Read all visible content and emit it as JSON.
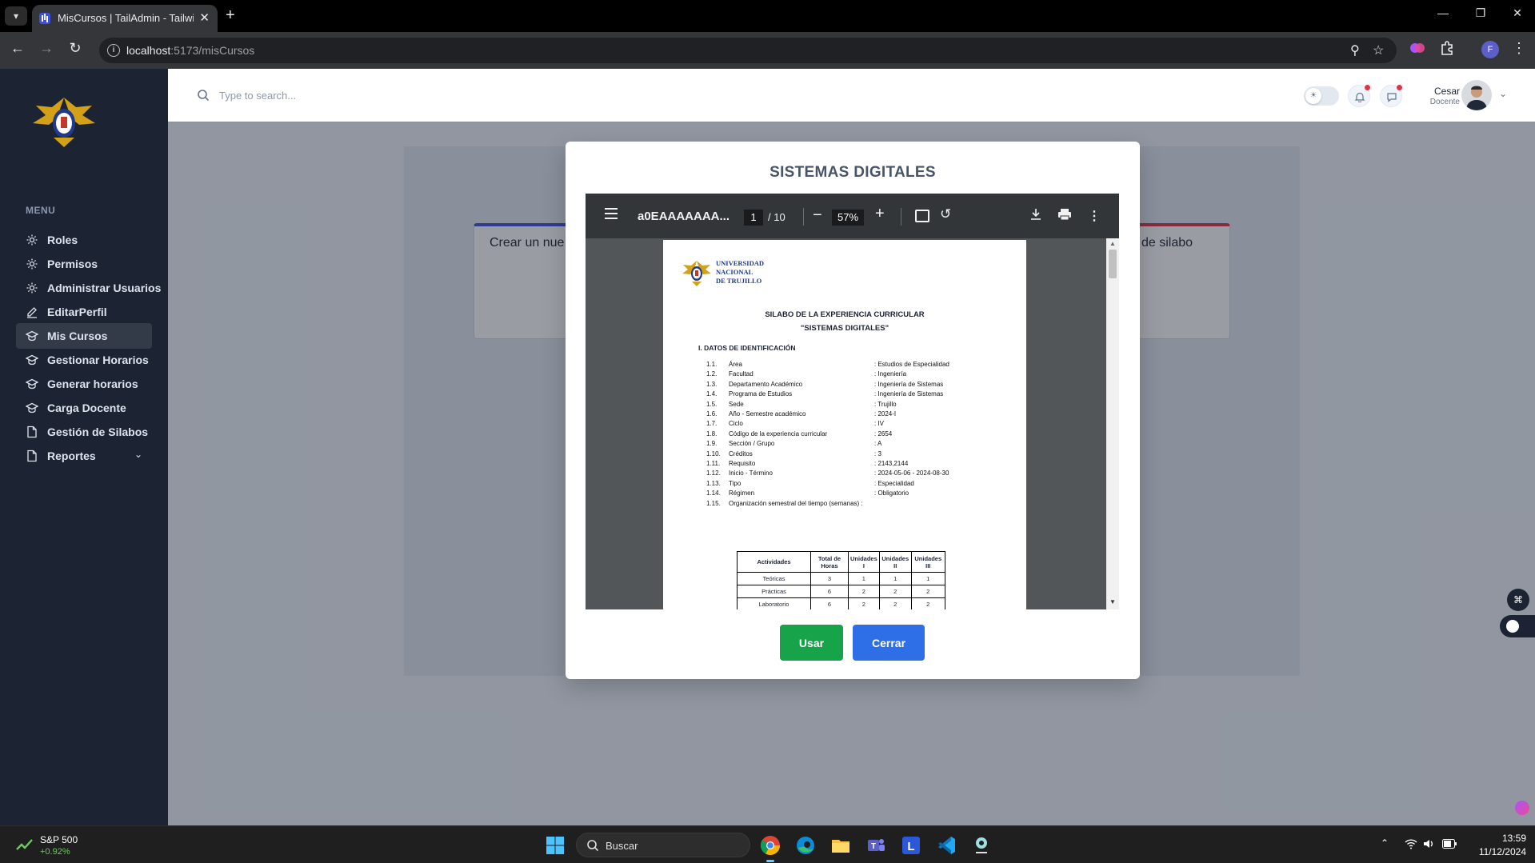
{
  "browser": {
    "tab_title": "MisCursos | TailAdmin - Tailwind",
    "new_tab_symbol": "+",
    "url_host": "localhost",
    "url_path": ":5173/misCursos",
    "profile_initial": "F"
  },
  "sidebar": {
    "menu_heading": "MENU",
    "items": [
      {
        "label": "Roles",
        "icon": "gear-icon"
      },
      {
        "label": "Permisos",
        "icon": "gear-icon"
      },
      {
        "label": "Administrar Usuarios",
        "icon": "gear-icon"
      },
      {
        "label": "EditarPerfil",
        "icon": "edit-icon"
      },
      {
        "label": "Mis Cursos",
        "icon": "graduation-cap-icon",
        "active": true
      },
      {
        "label": "Gestionar Horarios",
        "icon": "graduation-cap-icon"
      },
      {
        "label": "Generar horarios",
        "icon": "graduation-cap-icon"
      },
      {
        "label": "Carga Docente",
        "icon": "graduation-cap-icon"
      },
      {
        "label": "Gestión de Silabos",
        "icon": "document-icon"
      },
      {
        "label": "Reportes",
        "icon": "document-icon",
        "has_submenu": true
      }
    ]
  },
  "header": {
    "search_placeholder": "Type to search...",
    "user_name": "Cesar",
    "user_role": "Docente"
  },
  "background": {
    "card_left_text": "Crear un nue",
    "card_right_text": "de silabo"
  },
  "modal": {
    "title": "SISTEMAS DIGITALES",
    "pdf": {
      "filename": "a0EAAAAAAA...",
      "current_page": "1",
      "total_pages": "/ 10",
      "zoom": "57%"
    },
    "buttons": {
      "use_label": "Usar",
      "close_label": "Cerrar"
    }
  },
  "document": {
    "university_lines": [
      "UNIVERSIDAD",
      "NACIONAL",
      "DE TRUJILLO"
    ],
    "title_line1": "SILABO DE LA EXPERIENCIA CURRICULAR",
    "title_line2": "\"SISTEMAS DIGITALES\"",
    "section_title": "I. DATOS DE IDENTIFICACIÓN",
    "rows": [
      {
        "num": "1.1.",
        "label": "Área",
        "value": ": Estudios de Especialidad"
      },
      {
        "num": "1.2.",
        "label": "Facultad",
        "value": ": Ingeniería"
      },
      {
        "num": "1.3.",
        "label": "Departamento Académico",
        "value": ": Ingeniería de Sistemas"
      },
      {
        "num": "1.4.",
        "label": "Programa de Estudios",
        "value": ": Ingeniería de Sistemas"
      },
      {
        "num": "1.5.",
        "label": "Sede",
        "value": ": Trujillo"
      },
      {
        "num": "1.6.",
        "label": "Año - Semestre académico",
        "value": ": 2024-I"
      },
      {
        "num": "1.7.",
        "label": "Ciclo",
        "value": ": IV"
      },
      {
        "num": "1.8.",
        "label": "Código de la experiencia curricular",
        "value": ": 2654"
      },
      {
        "num": "1.9.",
        "label": "Sección / Grupo",
        "value": ": A"
      },
      {
        "num": "1.10.",
        "label": "Créditos",
        "value": ": 3"
      },
      {
        "num": "1.11.",
        "label": "Requisito",
        "value": ": 2143,2144"
      },
      {
        "num": "1.12.",
        "label": "Inicio - Término",
        "value": ": 2024-05-06 - 2024-08-30"
      },
      {
        "num": "1.13.",
        "label": "Tipo",
        "value": ": Especialidad"
      },
      {
        "num": "1.14.",
        "label": "Régimen",
        "value": ": Obligatorio"
      },
      {
        "num": "1.15.",
        "label": "Organización semestral del tiempo (semanas) :",
        "value": ""
      }
    ],
    "table": {
      "headers": [
        [
          "Actividades"
        ],
        [
          "Total de",
          "Horas"
        ],
        [
          "Unidades",
          "I"
        ],
        [
          "Unidades",
          "II"
        ],
        [
          "Unidades",
          "III"
        ]
      ],
      "rows": [
        [
          "Teóricas",
          "3",
          "1",
          "1",
          "1"
        ],
        [
          "Prácticas",
          "6",
          "2",
          "2",
          "2"
        ],
        [
          "Laboratorio",
          "6",
          "2",
          "2",
          "2"
        ]
      ]
    }
  },
  "taskbar": {
    "stock_name": "S&P 500",
    "stock_change": "+0.92%",
    "search_label": "Buscar",
    "time": "13:59",
    "date": "11/12/2024"
  }
}
